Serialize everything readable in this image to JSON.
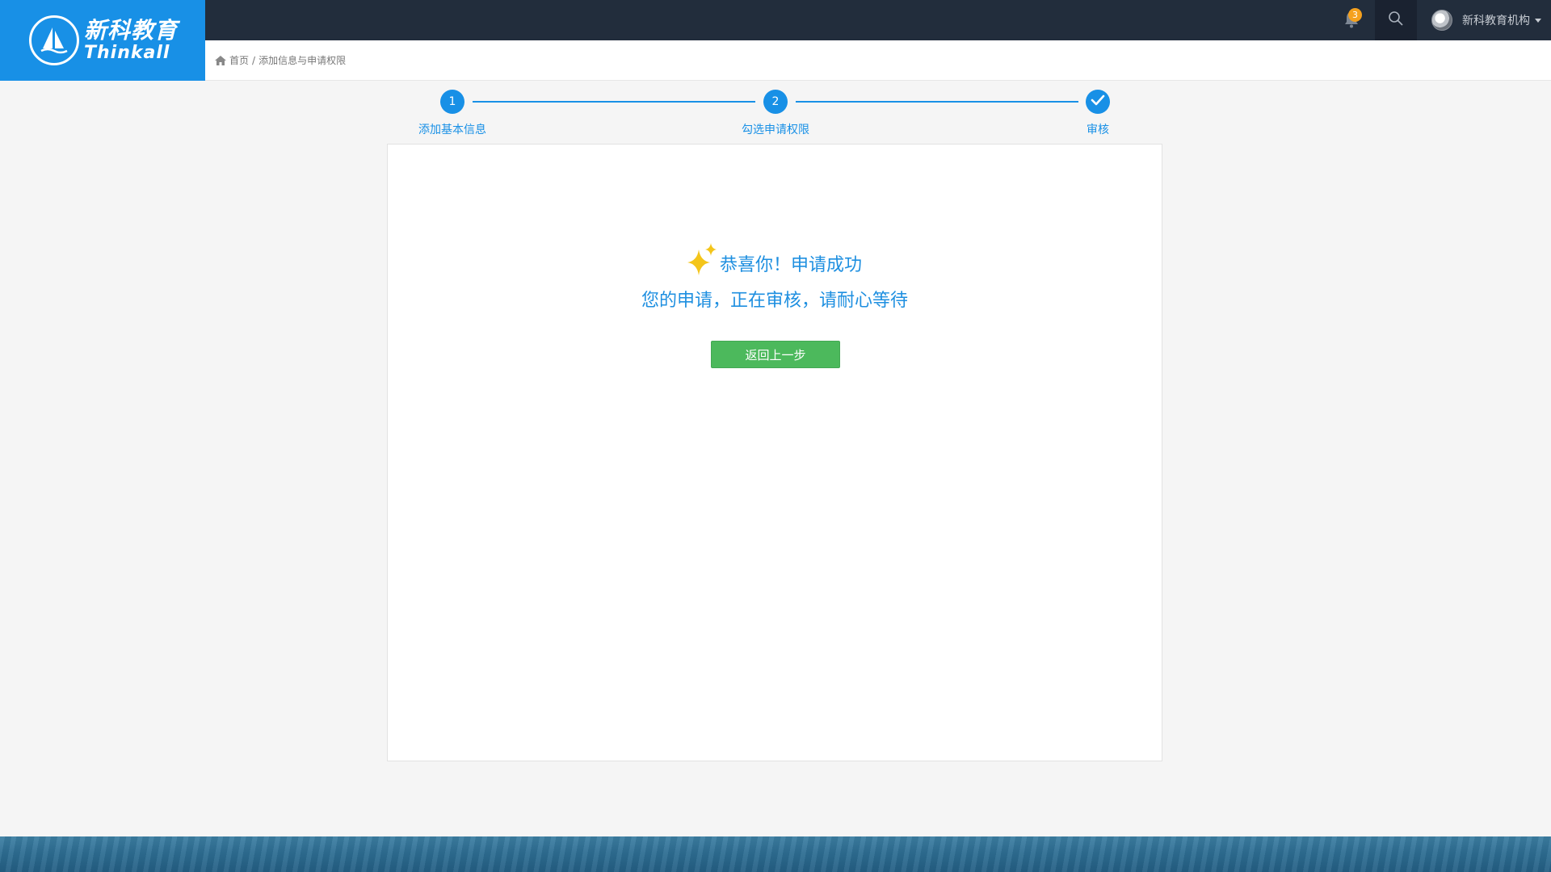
{
  "logo": {
    "name_cn": "新科教育",
    "name_en": "Thinkall"
  },
  "topbar": {
    "notification_count": "3",
    "user_name": "新科教育机构"
  },
  "breadcrumb": {
    "home": "首页",
    "separator": "/",
    "current": "添加信息与申请权限"
  },
  "steps": [
    {
      "marker": "1",
      "label": "添加基本信息"
    },
    {
      "marker": "2",
      "label": "勾选申请权限"
    },
    {
      "marker": "check-icon",
      "label": "审核"
    }
  ],
  "result": {
    "title": "恭喜你！申请成功",
    "message": "您的申请，正在审核，请耐心等待",
    "back_button": "返回上一步"
  },
  "colors": {
    "primary": "#1890e6",
    "topbar": "#222d3c",
    "success_button": "#4cb95c",
    "badge": "#f5a11e"
  }
}
